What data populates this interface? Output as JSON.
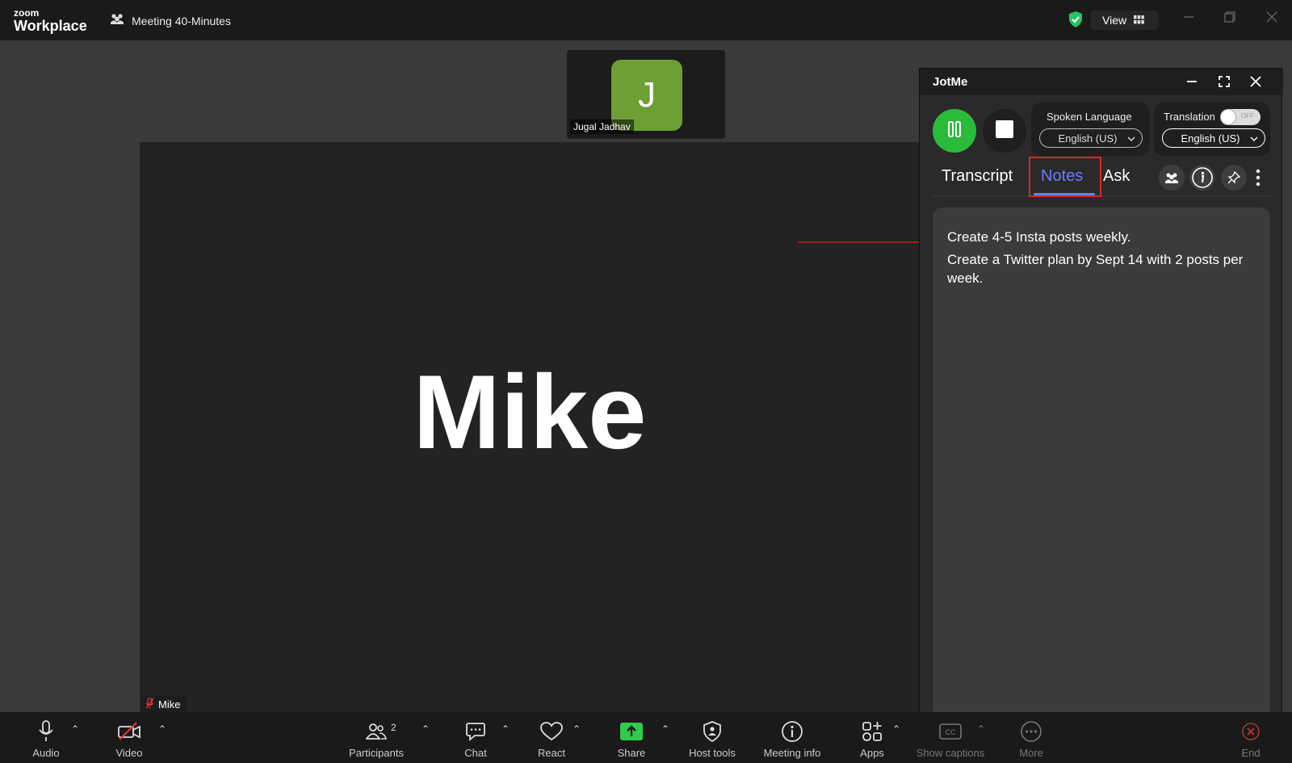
{
  "titlebar": {
    "logo_top": "zoom",
    "logo_bottom": "Workplace",
    "meeting_title": "Meeting 40-Minutes",
    "view_label": "View"
  },
  "thumbnail": {
    "initial": "J",
    "name": "Jugal Jadhav",
    "color": "#6e9f34"
  },
  "stage": {
    "speaker_name": "Mike",
    "name_label": "Mike"
  },
  "jotme": {
    "title": "JotMe",
    "spoken_language_label": "Spoken Language",
    "spoken_language_value": "English (US)",
    "translation_label": "Translation",
    "translation_toggle_text": "OFF",
    "translation_language_value": "English (US)",
    "tabs": [
      {
        "label": "Transcript"
      },
      {
        "label": "Notes"
      },
      {
        "label": "Ask"
      }
    ],
    "active_tab": "Notes",
    "notes": [
      {
        "text": "Create 4-5 Insta posts weekly."
      },
      {
        "text": "Create a Twitter plan by Sept 14 with 2 posts per week."
      }
    ],
    "accent_color": "#6b7cff",
    "record_color": "#2bbb3a"
  },
  "toolbar": {
    "audio": "Audio",
    "video": "Video",
    "participants": "Participants",
    "participants_count": "2",
    "chat": "Chat",
    "react": "React",
    "share": "Share",
    "host_tools": "Host tools",
    "meeting_info": "Meeting info",
    "apps": "Apps",
    "captions": "Show captions",
    "more": "More",
    "end": "End"
  }
}
